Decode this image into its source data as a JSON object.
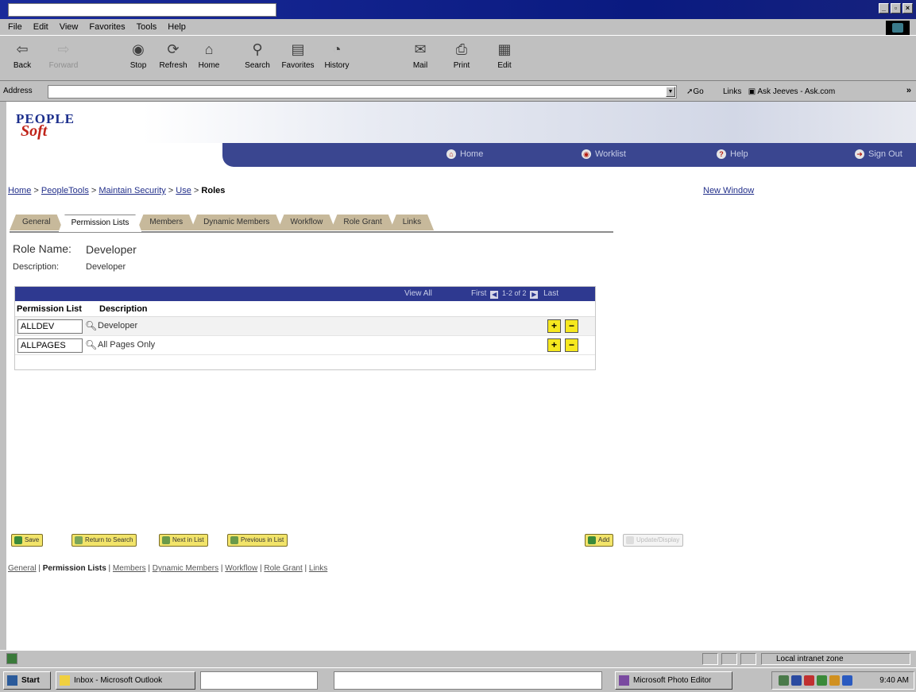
{
  "browser": {
    "menu": [
      "File",
      "Edit",
      "View",
      "Favorites",
      "Tools",
      "Help"
    ],
    "toolbar": [
      {
        "label": "Back",
        "icon": "back-arrow-icon"
      },
      {
        "label": "Forward",
        "icon": "forward-arrow-icon"
      },
      {
        "label": "Stop",
        "icon": "stop-icon"
      },
      {
        "label": "Refresh",
        "icon": "refresh-icon"
      },
      {
        "label": "Home",
        "icon": "home-icon"
      },
      {
        "label": "Search",
        "icon": "search-icon"
      },
      {
        "label": "Favorites",
        "icon": "favorites-icon"
      },
      {
        "label": "History",
        "icon": "history-icon"
      },
      {
        "label": "Mail",
        "icon": "mail-icon"
      },
      {
        "label": "Print",
        "icon": "print-icon"
      },
      {
        "label": "Edit",
        "icon": "edit-icon"
      }
    ],
    "address_label": "Address",
    "address_value": "",
    "go_label": "Go",
    "links_label": "Links",
    "links_item": "Ask Jeeves - Ask.com",
    "more": "»"
  },
  "ps": {
    "logo_top": "PEOPLE",
    "logo_bottom": "Soft",
    "nav": [
      "Home",
      "Worklist",
      "Help",
      "Sign Out"
    ],
    "breadcrumb": [
      "Home",
      "PeopleTools",
      "Maintain Security",
      "Use",
      "Roles"
    ],
    "new_window": "New Window",
    "tabs": [
      "General",
      "Permission Lists",
      "Members",
      "Dynamic Members",
      "Workflow",
      "Role Grant",
      "Links"
    ],
    "active_tab": "Permission Lists",
    "role_name_label": "Role Name:",
    "role_name_value": "Developer",
    "description_label": "Description:",
    "description_value": "Developer",
    "grid": {
      "view_all": "View All",
      "first": "First",
      "count": "1-2 of 2",
      "last": "Last",
      "col_permission": "Permission List",
      "col_description": "Description",
      "rows": [
        {
          "permission": "ALLDEV",
          "description": "Developer"
        },
        {
          "permission": "ALLPAGES",
          "description": "All Pages Only"
        }
      ]
    },
    "actions": {
      "save": "Save",
      "return": "Return to Search",
      "next": "Next in List",
      "previous": "Previous in List",
      "add": "Add",
      "update": "Update/Display"
    },
    "bottom_links": [
      "General",
      "Permission Lists",
      "Members",
      "Dynamic Members",
      "Workflow",
      "Role Grant",
      "Links"
    ]
  },
  "status": {
    "zone": "Local intranet zone"
  },
  "taskbar": {
    "start": "Start",
    "items": [
      "Inbox - Microsoft Outlook",
      "",
      "",
      "Microsoft Photo Editor"
    ],
    "time": "9:40 AM"
  },
  "colors": {
    "nav_bg": "#3a4690",
    "grid_header": "#2e3990",
    "tab_inactive": "#c7b99b",
    "button_yellow": "#f6e81f",
    "title_bar": "#0a1a80"
  }
}
